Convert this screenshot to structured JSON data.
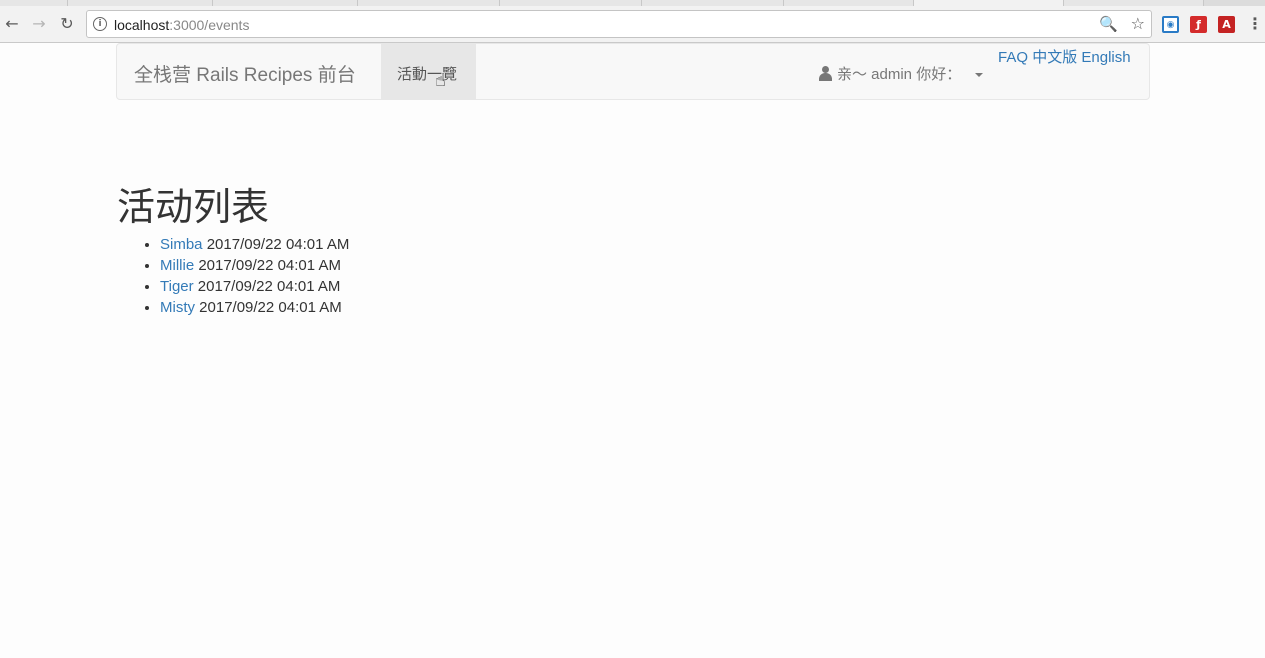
{
  "browser": {
    "url_host": "localhost",
    "url_path": ":3000/events"
  },
  "navbar": {
    "brand": "全栈营 Rails Recipes 前台",
    "active_nav": "活動一覽",
    "user_greeting": "亲～ admin 你好：",
    "lang_links": [
      "FAQ",
      "中文版",
      "English"
    ]
  },
  "main": {
    "title": "活动列表",
    "events": [
      {
        "name": "Simba",
        "time": "2017/09/22 04:01 AM"
      },
      {
        "name": "Millie",
        "time": "2017/09/22 04:01 AM"
      },
      {
        "name": "Tiger",
        "time": "2017/09/22 04:01 AM"
      },
      {
        "name": "Misty",
        "time": "2017/09/22 04:01 AM"
      }
    ]
  },
  "icons": {
    "back": "back-arrow-icon",
    "forward": "forward-arrow-icon",
    "reload": "reload-icon",
    "info": "info-icon",
    "zoom": "zoom-icon",
    "bookmark": "star-icon",
    "user": "user-icon",
    "menu": "more-vert-icon"
  }
}
